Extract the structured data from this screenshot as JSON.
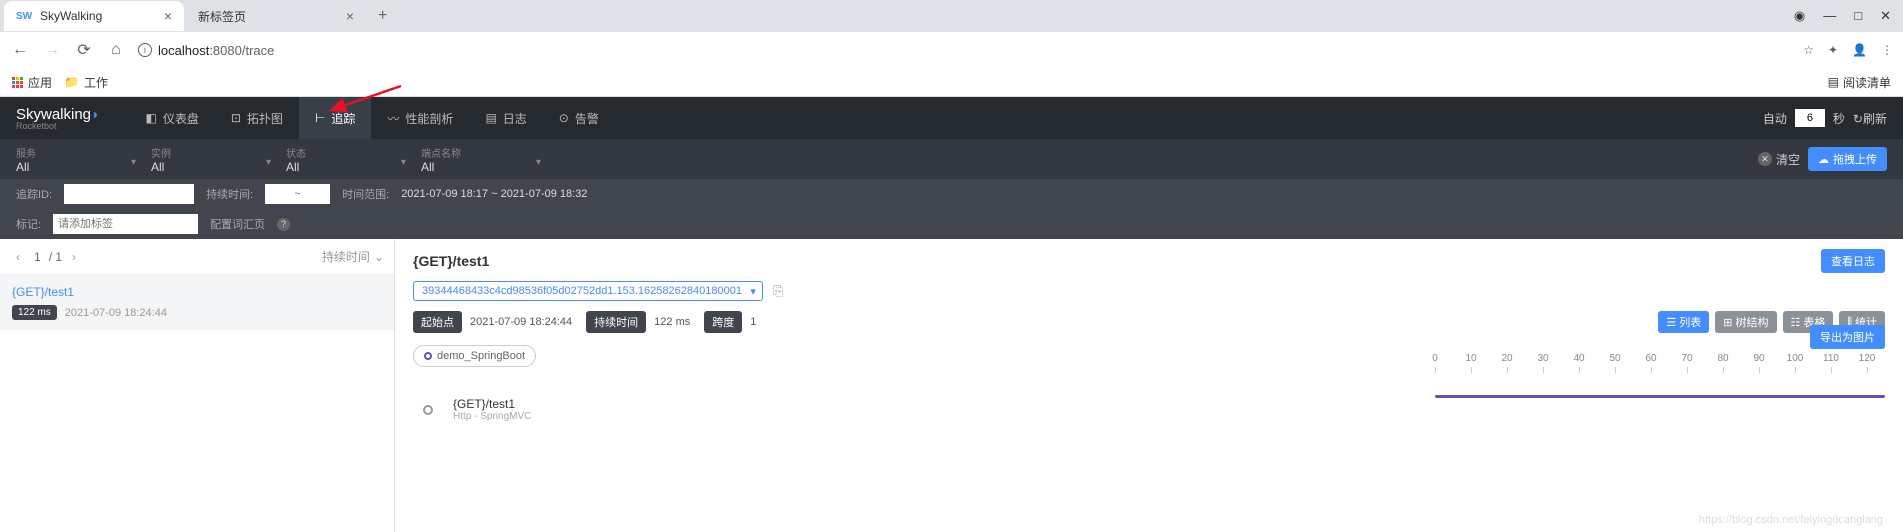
{
  "browser": {
    "tabs": [
      {
        "favicon": "SW",
        "title": "SkyWalking"
      },
      {
        "favicon": "",
        "title": "新标签页"
      }
    ],
    "url_host": "localhost",
    "url_port": ":8080",
    "url_path": "/trace",
    "bookmarks": {
      "apps": "应用",
      "work": "工作"
    },
    "reading_list": "阅读清单",
    "window": {
      "minimize": "—",
      "maximize": "□",
      "close": "✕"
    }
  },
  "header": {
    "logo": "Skywalking",
    "sublogo": "Rocketbot",
    "nav": [
      {
        "icon": "◧",
        "label": "仪表盘"
      },
      {
        "icon": "⊡",
        "label": "拓扑图"
      },
      {
        "icon": "⊢",
        "label": "追踪",
        "active": true
      },
      {
        "icon": "〰",
        "label": "性能剖析"
      },
      {
        "icon": "▤",
        "label": "日志"
      },
      {
        "icon": "⊙",
        "label": "告警"
      }
    ],
    "auto": "自动",
    "seconds": "6",
    "sec_label": "秒",
    "refresh": "刷新"
  },
  "filters": {
    "service": {
      "label": "服务",
      "value": "All"
    },
    "instance": {
      "label": "实例",
      "value": "All"
    },
    "status": {
      "label": "状态",
      "value": "All"
    },
    "endpoint": {
      "label": "端点名称",
      "value": "All"
    },
    "clear": "清空",
    "upload": "拖拽上传"
  },
  "filter2": {
    "trace_id_label": "追踪ID:",
    "duration_label": "持续时间:",
    "duration_placeholder": "~",
    "time_range_label": "时间范围:",
    "time_range": "2021-07-09 18:17 ~ 2021-07-09 18:32"
  },
  "filter3": {
    "tag_label": "标记:",
    "tag_placeholder": "请添加标签",
    "vocab": "配置词汇页"
  },
  "pagination": {
    "current": "1",
    "total": "/  1",
    "sort": "持续时间"
  },
  "trace_list": [
    {
      "name": "{GET}/test1",
      "duration": "122 ms",
      "time": "2021-07-09 18:24:44"
    }
  ],
  "detail": {
    "title": "{GET}/test1",
    "view_log": "查看日志",
    "trace_id": "39344468433c4cd98536f05d02752dd1.153.16258262840180001",
    "start_label": "起始点",
    "start_time": "2021-07-09 18:24:44",
    "duration_label": "持续时间",
    "duration_value": "122 ms",
    "span_label": "跨度",
    "span_count": "1",
    "views": {
      "list": "列表",
      "tree": "树结构",
      "table": "表格",
      "stats": "统计"
    },
    "service_chip": "demo_SpringBoot",
    "export": "导出为图片",
    "ticks": [
      "0",
      "10",
      "20",
      "30",
      "40",
      "50",
      "60",
      "70",
      "80",
      "90",
      "100",
      "110",
      "120"
    ],
    "span": {
      "name": "{GET}/test1",
      "component": "Http - SpringMVC"
    }
  },
  "watermark": "https://blog.csdn.net/feiying0canglang"
}
